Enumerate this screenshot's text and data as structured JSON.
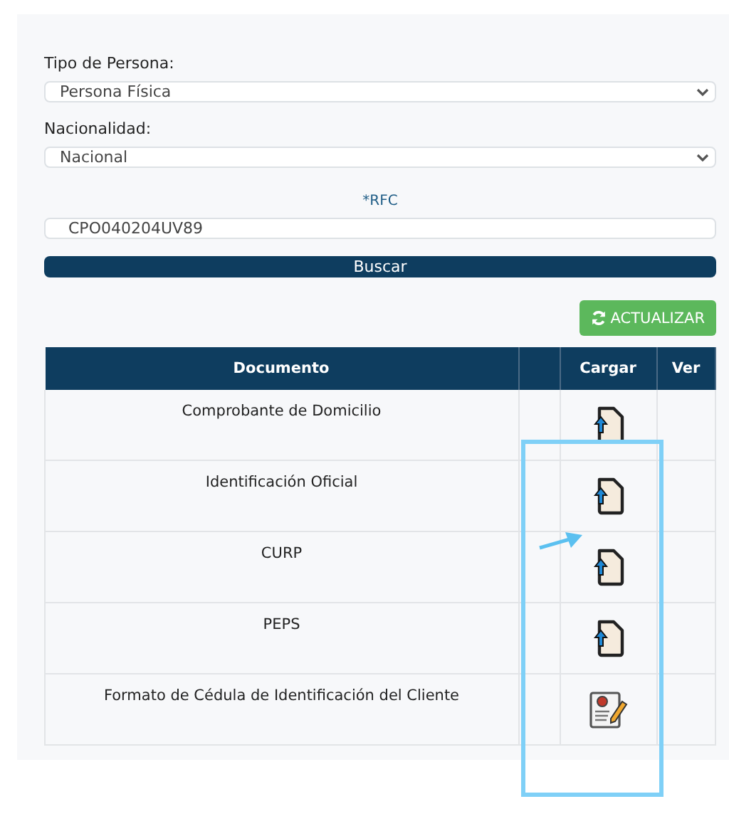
{
  "form": {
    "fields": [
      {
        "label": "Tipo de Persona:",
        "kind": "select",
        "value": "Persona Física"
      },
      {
        "label": "Nacionalidad:",
        "kind": "select",
        "value": "Nacional"
      }
    ],
    "rfc": {
      "label": "*RFC",
      "value": "CPO040204UV89"
    },
    "search_button": "Buscar",
    "refresh_button": "ACTUALIZAR"
  },
  "table": {
    "columns": [
      "Documento",
      "",
      "Cargar",
      "Ver"
    ],
    "rows": [
      {
        "document": "Comprobante de Domicilio",
        "kind": "upload"
      },
      {
        "document": "Identificación Oficial",
        "kind": "upload"
      },
      {
        "document": "CURP",
        "kind": "upload"
      },
      {
        "document": "PEPS",
        "kind": "upload"
      },
      {
        "document": "Formato de Cédula de Identificación del Cliente",
        "kind": "form"
      }
    ]
  }
}
